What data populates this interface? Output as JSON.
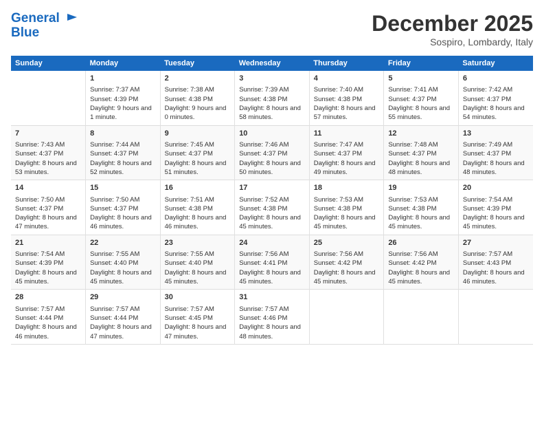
{
  "header": {
    "logo_line1": "General",
    "logo_line2": "Blue",
    "month": "December 2025",
    "location": "Sospiro, Lombardy, Italy"
  },
  "days_of_week": [
    "Sunday",
    "Monday",
    "Tuesday",
    "Wednesday",
    "Thursday",
    "Friday",
    "Saturday"
  ],
  "weeks": [
    [
      {
        "day": "",
        "sunrise": "",
        "sunset": "",
        "daylight": ""
      },
      {
        "day": "1",
        "sunrise": "Sunrise: 7:37 AM",
        "sunset": "Sunset: 4:39 PM",
        "daylight": "Daylight: 9 hours and 1 minute."
      },
      {
        "day": "2",
        "sunrise": "Sunrise: 7:38 AM",
        "sunset": "Sunset: 4:38 PM",
        "daylight": "Daylight: 9 hours and 0 minutes."
      },
      {
        "day": "3",
        "sunrise": "Sunrise: 7:39 AM",
        "sunset": "Sunset: 4:38 PM",
        "daylight": "Daylight: 8 hours and 58 minutes."
      },
      {
        "day": "4",
        "sunrise": "Sunrise: 7:40 AM",
        "sunset": "Sunset: 4:38 PM",
        "daylight": "Daylight: 8 hours and 57 minutes."
      },
      {
        "day": "5",
        "sunrise": "Sunrise: 7:41 AM",
        "sunset": "Sunset: 4:37 PM",
        "daylight": "Daylight: 8 hours and 55 minutes."
      },
      {
        "day": "6",
        "sunrise": "Sunrise: 7:42 AM",
        "sunset": "Sunset: 4:37 PM",
        "daylight": "Daylight: 8 hours and 54 minutes."
      }
    ],
    [
      {
        "day": "7",
        "sunrise": "Sunrise: 7:43 AM",
        "sunset": "Sunset: 4:37 PM",
        "daylight": "Daylight: 8 hours and 53 minutes."
      },
      {
        "day": "8",
        "sunrise": "Sunrise: 7:44 AM",
        "sunset": "Sunset: 4:37 PM",
        "daylight": "Daylight: 8 hours and 52 minutes."
      },
      {
        "day": "9",
        "sunrise": "Sunrise: 7:45 AM",
        "sunset": "Sunset: 4:37 PM",
        "daylight": "Daylight: 8 hours and 51 minutes."
      },
      {
        "day": "10",
        "sunrise": "Sunrise: 7:46 AM",
        "sunset": "Sunset: 4:37 PM",
        "daylight": "Daylight: 8 hours and 50 minutes."
      },
      {
        "day": "11",
        "sunrise": "Sunrise: 7:47 AM",
        "sunset": "Sunset: 4:37 PM",
        "daylight": "Daylight: 8 hours and 49 minutes."
      },
      {
        "day": "12",
        "sunrise": "Sunrise: 7:48 AM",
        "sunset": "Sunset: 4:37 PM",
        "daylight": "Daylight: 8 hours and 48 minutes."
      },
      {
        "day": "13",
        "sunrise": "Sunrise: 7:49 AM",
        "sunset": "Sunset: 4:37 PM",
        "daylight": "Daylight: 8 hours and 48 minutes."
      }
    ],
    [
      {
        "day": "14",
        "sunrise": "Sunrise: 7:50 AM",
        "sunset": "Sunset: 4:37 PM",
        "daylight": "Daylight: 8 hours and 47 minutes."
      },
      {
        "day": "15",
        "sunrise": "Sunrise: 7:50 AM",
        "sunset": "Sunset: 4:37 PM",
        "daylight": "Daylight: 8 hours and 46 minutes."
      },
      {
        "day": "16",
        "sunrise": "Sunrise: 7:51 AM",
        "sunset": "Sunset: 4:38 PM",
        "daylight": "Daylight: 8 hours and 46 minutes."
      },
      {
        "day": "17",
        "sunrise": "Sunrise: 7:52 AM",
        "sunset": "Sunset: 4:38 PM",
        "daylight": "Daylight: 8 hours and 45 minutes."
      },
      {
        "day": "18",
        "sunrise": "Sunrise: 7:53 AM",
        "sunset": "Sunset: 4:38 PM",
        "daylight": "Daylight: 8 hours and 45 minutes."
      },
      {
        "day": "19",
        "sunrise": "Sunrise: 7:53 AM",
        "sunset": "Sunset: 4:38 PM",
        "daylight": "Daylight: 8 hours and 45 minutes."
      },
      {
        "day": "20",
        "sunrise": "Sunrise: 7:54 AM",
        "sunset": "Sunset: 4:39 PM",
        "daylight": "Daylight: 8 hours and 45 minutes."
      }
    ],
    [
      {
        "day": "21",
        "sunrise": "Sunrise: 7:54 AM",
        "sunset": "Sunset: 4:39 PM",
        "daylight": "Daylight: 8 hours and 45 minutes."
      },
      {
        "day": "22",
        "sunrise": "Sunrise: 7:55 AM",
        "sunset": "Sunset: 4:40 PM",
        "daylight": "Daylight: 8 hours and 45 minutes."
      },
      {
        "day": "23",
        "sunrise": "Sunrise: 7:55 AM",
        "sunset": "Sunset: 4:40 PM",
        "daylight": "Daylight: 8 hours and 45 minutes."
      },
      {
        "day": "24",
        "sunrise": "Sunrise: 7:56 AM",
        "sunset": "Sunset: 4:41 PM",
        "daylight": "Daylight: 8 hours and 45 minutes."
      },
      {
        "day": "25",
        "sunrise": "Sunrise: 7:56 AM",
        "sunset": "Sunset: 4:42 PM",
        "daylight": "Daylight: 8 hours and 45 minutes."
      },
      {
        "day": "26",
        "sunrise": "Sunrise: 7:56 AM",
        "sunset": "Sunset: 4:42 PM",
        "daylight": "Daylight: 8 hours and 45 minutes."
      },
      {
        "day": "27",
        "sunrise": "Sunrise: 7:57 AM",
        "sunset": "Sunset: 4:43 PM",
        "daylight": "Daylight: 8 hours and 46 minutes."
      }
    ],
    [
      {
        "day": "28",
        "sunrise": "Sunrise: 7:57 AM",
        "sunset": "Sunset: 4:44 PM",
        "daylight": "Daylight: 8 hours and 46 minutes."
      },
      {
        "day": "29",
        "sunrise": "Sunrise: 7:57 AM",
        "sunset": "Sunset: 4:44 PM",
        "daylight": "Daylight: 8 hours and 47 minutes."
      },
      {
        "day": "30",
        "sunrise": "Sunrise: 7:57 AM",
        "sunset": "Sunset: 4:45 PM",
        "daylight": "Daylight: 8 hours and 47 minutes."
      },
      {
        "day": "31",
        "sunrise": "Sunrise: 7:57 AM",
        "sunset": "Sunset: 4:46 PM",
        "daylight": "Daylight: 8 hours and 48 minutes."
      },
      {
        "day": "",
        "sunrise": "",
        "sunset": "",
        "daylight": ""
      },
      {
        "day": "",
        "sunrise": "",
        "sunset": "",
        "daylight": ""
      },
      {
        "day": "",
        "sunrise": "",
        "sunset": "",
        "daylight": ""
      }
    ]
  ]
}
